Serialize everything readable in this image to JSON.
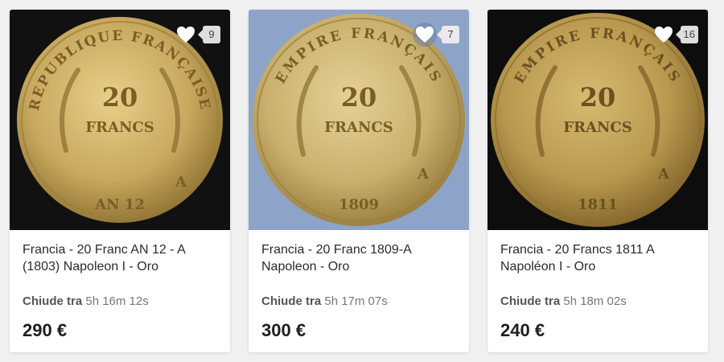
{
  "cards": [
    {
      "title": "Francia - 20 Franc AN 12 - A (1803) Napoleon I - Oro",
      "ends_label": "Chiude tra",
      "time_left": "5h 16m 12s",
      "price": "290 €",
      "fav_count": "9",
      "coin": {
        "top": "REPUBLIQUE FRANÇAISE",
        "denomination": "20",
        "unit": "FRANCS",
        "bottom": "AN 12",
        "mint": "A"
      },
      "background": "#111111"
    },
    {
      "title": "Francia - 20 Franc 1809-A Napoleon - Oro",
      "ends_label": "Chiude tra",
      "time_left": "5h 17m 07s",
      "price": "300 €",
      "fav_count": "7",
      "coin": {
        "top": "EMPIRE FRANÇAIS",
        "denomination": "20",
        "unit": "FRANCS",
        "bottom": "1809",
        "mint": "A"
      },
      "background": "#8ea3c8"
    },
    {
      "title": "Francia - 20 Francs 1811 A Napoléon I - Oro",
      "ends_label": "Chiude tra",
      "time_left": "5h 18m 02s",
      "price": "240 €",
      "fav_count": "16",
      "coin": {
        "top": "EMPIRE FRANÇAIS",
        "denomination": "20",
        "unit": "FRANCS",
        "bottom": "1811",
        "mint": "A"
      },
      "background": "#0d0d0d"
    }
  ],
  "icons": {
    "favorite": "heart-icon"
  },
  "colors": {
    "gold_light": "#d9c07a",
    "gold_dark": "#9c7d38"
  }
}
